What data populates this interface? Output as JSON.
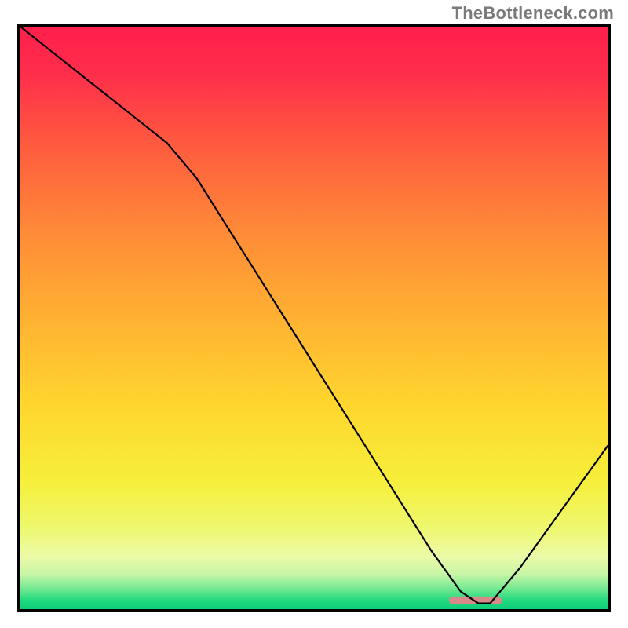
{
  "watermark": "TheBottleneck.com",
  "chart_data": {
    "type": "line",
    "title": "",
    "xlabel": "",
    "ylabel": "",
    "xlim": [
      0,
      100
    ],
    "ylim": [
      0,
      100
    ],
    "grid": false,
    "legend": false,
    "series": [
      {
        "name": "bottleneck-curve",
        "x": [
          0,
          5,
          10,
          15,
          20,
          25,
          30,
          35,
          40,
          45,
          50,
          55,
          60,
          65,
          70,
          75,
          78,
          80,
          85,
          90,
          95,
          100
        ],
        "y": [
          100,
          96,
          92,
          88,
          84,
          80,
          74,
          66,
          58,
          50,
          42,
          34,
          26,
          18,
          10,
          3,
          1,
          1,
          7,
          14,
          21,
          28
        ]
      }
    ],
    "marker": {
      "name": "optimal-range",
      "x_start": 73,
      "x_end": 82,
      "y": 1.5,
      "color": "#d88a8a"
    },
    "gradient_stops": [
      {
        "offset": 0.0,
        "color": "#ff1f4b"
      },
      {
        "offset": 0.08,
        "color": "#ff2e4b"
      },
      {
        "offset": 0.2,
        "color": "#ff5a3f"
      },
      {
        "offset": 0.35,
        "color": "#ff8a38"
      },
      {
        "offset": 0.5,
        "color": "#ffb132"
      },
      {
        "offset": 0.65,
        "color": "#ffd62e"
      },
      {
        "offset": 0.78,
        "color": "#f6ef3a"
      },
      {
        "offset": 0.86,
        "color": "#eef86e"
      },
      {
        "offset": 0.91,
        "color": "#ecfaa8"
      },
      {
        "offset": 0.94,
        "color": "#c7f6a6"
      },
      {
        "offset": 0.965,
        "color": "#73e991"
      },
      {
        "offset": 0.985,
        "color": "#1fd97f"
      },
      {
        "offset": 1.0,
        "color": "#0fce78"
      }
    ]
  }
}
